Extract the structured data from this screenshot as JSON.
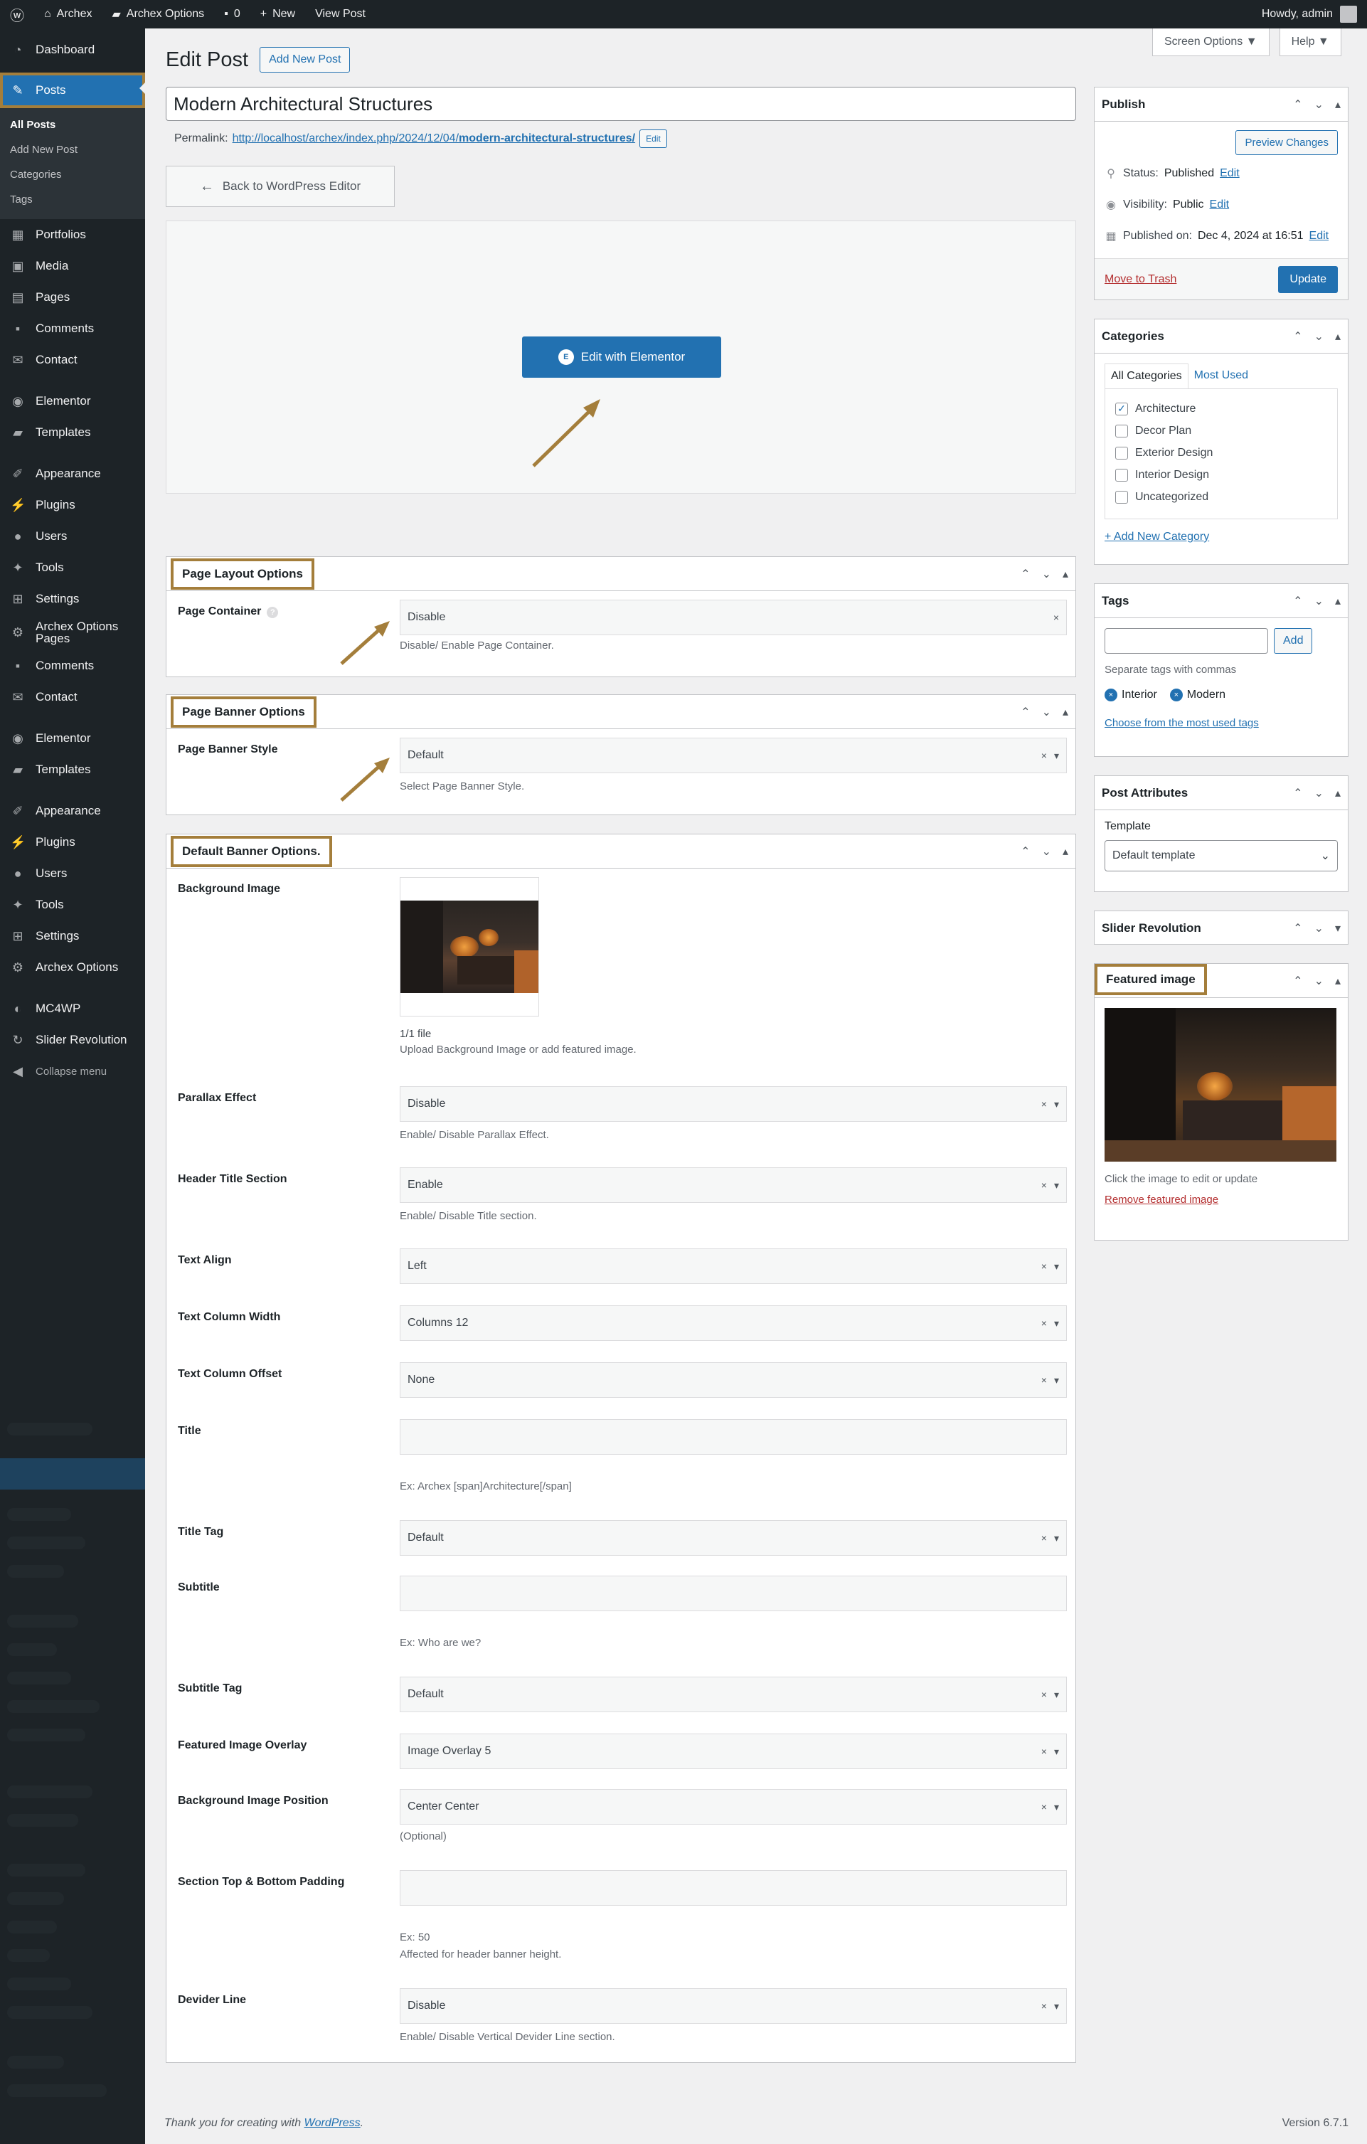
{
  "adminbar": {
    "site": "Archex",
    "options": "Archex Options",
    "comments": "0",
    "new": "New",
    "view": "View Post",
    "howdy": "Howdy, admin"
  },
  "sidebar": {
    "items1": [
      "Dashboard"
    ],
    "active": "Posts",
    "submenu": [
      "All Posts",
      "Add New Post",
      "Categories",
      "Tags"
    ],
    "items2": [
      "Portfolios",
      "Media",
      "Pages",
      "Comments",
      "Contact"
    ],
    "items3": [
      "Elementor",
      "Templates"
    ],
    "items4": [
      "Appearance",
      "Plugins",
      "Users",
      "Tools",
      "Settings"
    ],
    "archex": "Archex Options Pages",
    "items5": [
      "Comments",
      "Contact"
    ],
    "items6": [
      "Elementor",
      "Templates"
    ],
    "items7": [
      "Appearance",
      "Plugins",
      "Users",
      "Tools",
      "Settings",
      "Archex Options"
    ],
    "items8": [
      "MC4WP",
      "Slider Revolution"
    ],
    "collapse": "Collapse menu"
  },
  "screen_options": "Screen Options ▼",
  "help": "Help ▼",
  "page_title": "Edit Post",
  "add_new": "Add New Post",
  "post_title": "Modern Architectural Structures",
  "permalink": {
    "label": "Permalink:",
    "url_base": "http://localhost/archex/index.php/2024/12/04/",
    "slug": "modern-architectural-structures/",
    "edit": "Edit"
  },
  "back_editor": "Back to WordPress Editor",
  "edit_elementor": "Edit with Elementor",
  "layout_box": {
    "title": "Page Layout Options",
    "label": "Page Container",
    "value": "Disable",
    "desc": "Disable/ Enable Page Container."
  },
  "banner_box": {
    "title": "Page Banner Options",
    "label": "Page Banner Style",
    "value": "Default",
    "desc": "Select Page Banner Style."
  },
  "default_banner": {
    "title": "Default Banner Options.",
    "bg_label": "Background Image",
    "file_count": "1/1 file",
    "bg_desc": "Upload Background Image or add featured image.",
    "fields": [
      {
        "label": "Parallax Effect",
        "value": "Disable",
        "desc": "Enable/ Disable Parallax Effect."
      },
      {
        "label": "Header Title Section",
        "value": "Enable",
        "desc": "Enable/ Disable Title section."
      },
      {
        "label": "Text Align",
        "value": "Left",
        "desc": ""
      },
      {
        "label": "Text Column Width",
        "value": "Columns 12",
        "desc": ""
      },
      {
        "label": "Text Column Offset",
        "value": "None",
        "desc": ""
      },
      {
        "label": "Title",
        "value": "",
        "desc": "Ex: Archex [span]Architecture[/span]"
      },
      {
        "label": "Title Tag",
        "value": "Default",
        "desc": ""
      },
      {
        "label": "Subtitle",
        "value": "",
        "desc": "Ex: Who are we?"
      },
      {
        "label": "Subtitle Tag",
        "value": "Default",
        "desc": ""
      },
      {
        "label": "Featured Image Overlay",
        "value": "Image Overlay 5",
        "desc": ""
      },
      {
        "label": "Background Image Position",
        "value": "Center Center",
        "desc": "(Optional)"
      },
      {
        "label": "Section Top & Bottom Padding",
        "value": "",
        "desc": "Ex: 50"
      },
      {
        "label": "Devider Line",
        "value": "Disable",
        "desc": "Enable/ Disable Vertical Devider Line section."
      }
    ],
    "padding_desc2": "Affected for header banner height."
  },
  "publish": {
    "title": "Publish",
    "preview": "Preview Changes",
    "status_label": "Status:",
    "status": "Published",
    "visibility_label": "Visibility:",
    "visibility": "Public",
    "published_label": "Published on:",
    "published": "Dec 4, 2024 at 16:51",
    "edit": "Edit",
    "trash": "Move to Trash",
    "update": "Update"
  },
  "categories": {
    "title": "Categories",
    "tab_all": "All Categories",
    "tab_used": "Most Used",
    "items": [
      {
        "name": "Architecture",
        "checked": true
      },
      {
        "name": "Decor Plan",
        "checked": false
      },
      {
        "name": "Exterior Design",
        "checked": false
      },
      {
        "name": "Interior Design",
        "checked": false
      },
      {
        "name": "Uncategorized",
        "checked": false
      }
    ],
    "add_new": "+ Add New Category"
  },
  "tags": {
    "title": "Tags",
    "add": "Add",
    "hint": "Separate tags with commas",
    "chips": [
      "Interior",
      "Modern"
    ],
    "choose": "Choose from the most used tags"
  },
  "attributes": {
    "title": "Post Attributes",
    "template_label": "Template",
    "template_value": "Default template"
  },
  "slider": {
    "title": "Slider Revolution"
  },
  "featured": {
    "title": "Featured image",
    "hint": "Click the image to edit or update",
    "remove": "Remove featured image"
  },
  "footer": {
    "text": "Thank you for creating with",
    "link": "WordPress",
    "end": ".",
    "version": "Version 6.7.1"
  },
  "colors": {
    "accent": "#2271b1",
    "highlight": "#a47e3b",
    "sidebar": "#1d2327"
  }
}
